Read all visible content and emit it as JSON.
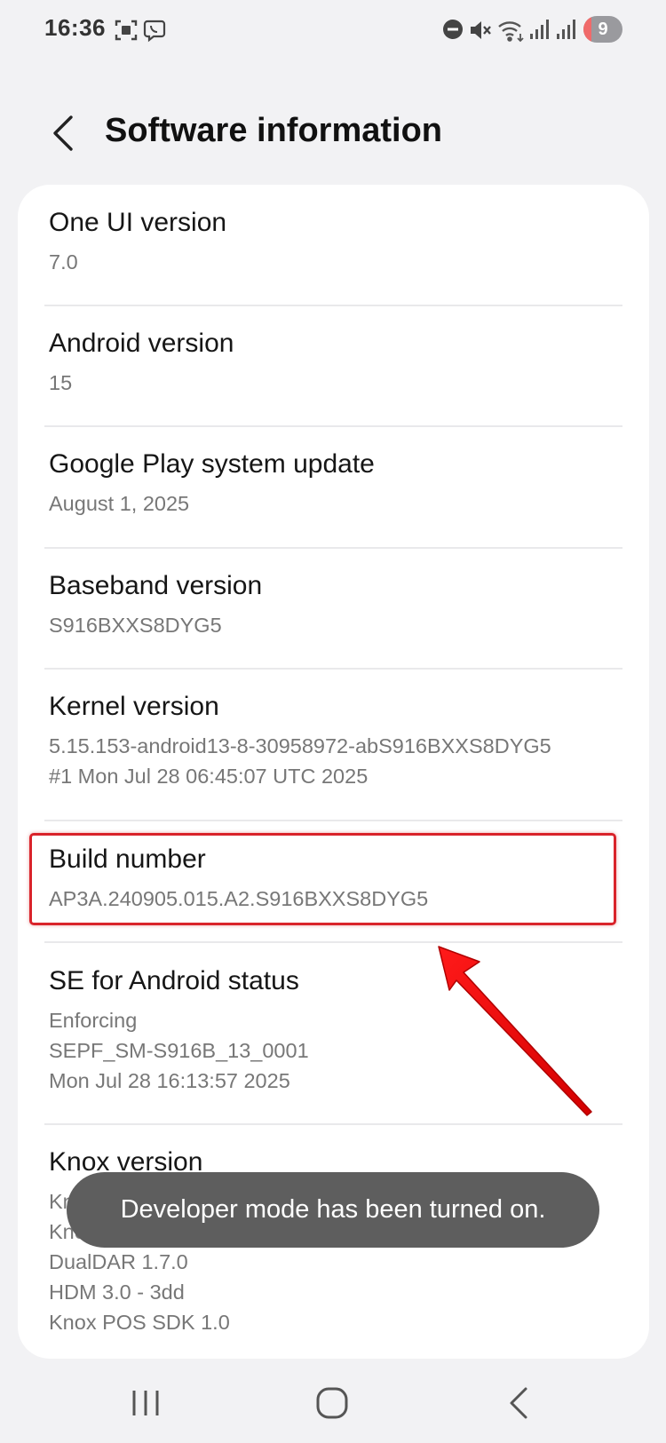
{
  "status_bar": {
    "time": "16:36",
    "battery_level": "9",
    "icons_left": [
      "screenshot-icon",
      "viber-icon"
    ],
    "icons_right": [
      "dnd-icon",
      "mute-icon",
      "wifi-icon",
      "signal-icon",
      "signal-icon"
    ]
  },
  "header": {
    "title": "Software information"
  },
  "items": [
    {
      "title": "One UI version",
      "lines": [
        "7.0"
      ]
    },
    {
      "title": "Android version",
      "lines": [
        "15"
      ]
    },
    {
      "title": "Google Play system update",
      "lines": [
        "August 1, 2025"
      ]
    },
    {
      "title": "Baseband version",
      "lines": [
        "S916BXXS8DYG5"
      ]
    },
    {
      "title": "Kernel version",
      "lines": [
        "5.15.153-android13-8-30958972-abS916BXXS8DYG5",
        "#1 Mon Jul 28 06:45:07 UTC 2025"
      ]
    },
    {
      "title": "Build number",
      "lines": [
        "AP3A.240905.015.A2.S916BXXS8DYG5"
      ]
    },
    {
      "title": "SE for Android status",
      "lines": [
        "Enforcing",
        "SEPF_SM-S916B_13_0001",
        "Mon Jul 28 16:13:57 2025"
      ]
    },
    {
      "title": "Knox version",
      "lines": [
        "Knox 3.11",
        "Knox API level 38",
        "DualDAR 1.7.0",
        "HDM 3.0 - 3dd",
        "Knox POS SDK 1.0"
      ]
    }
  ],
  "toast": {
    "message": "Developer mode has been turned on."
  },
  "colors": {
    "highlight": "#d9232a",
    "toast_bg": "#5e5e5e",
    "battery_low": "#f06a6a"
  }
}
